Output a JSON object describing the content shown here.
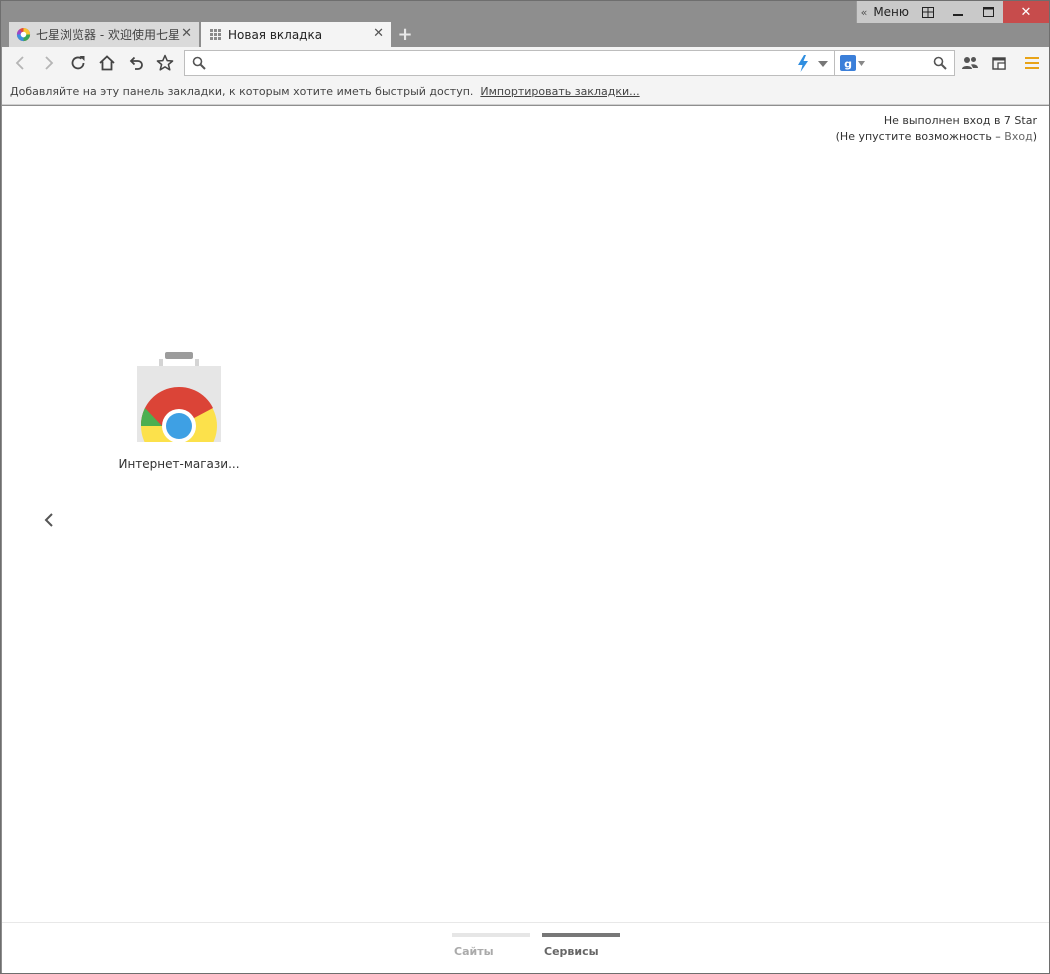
{
  "window": {
    "menu_label": "Меню",
    "controls": [
      "restore-layout",
      "minimize",
      "maximize",
      "close"
    ]
  },
  "tabs": [
    {
      "title": "七星浏览器 - 欢迎使用七星",
      "icon": "seven-star-logo-icon",
      "active": false
    },
    {
      "title": "Новая вкладка",
      "icon": "grid-apps-icon",
      "active": true
    }
  ],
  "toolbar": {
    "address_value": "",
    "address_placeholder": "",
    "search_engine": "Google",
    "search_value": "",
    "accent_color": "#e8a317"
  },
  "bookmarks_bar": {
    "hint": "Добавляйте на эту панель закладки, к которым хотите иметь быстрый доступ.",
    "import_link": "Импортировать закладки..."
  },
  "signin": {
    "line1": "Не выполнен вход в 7 Star",
    "line2_prefix": "(Не упустите возможность – ",
    "login_link": "Вход",
    "line2_suffix": ")"
  },
  "apps": [
    {
      "label": "Интернет-магази...",
      "icon": "chrome-web-store-icon"
    }
  ],
  "pager": {
    "tabs": [
      {
        "label": "Сайты",
        "selected": false
      },
      {
        "label": "Сервисы",
        "selected": true
      }
    ]
  }
}
